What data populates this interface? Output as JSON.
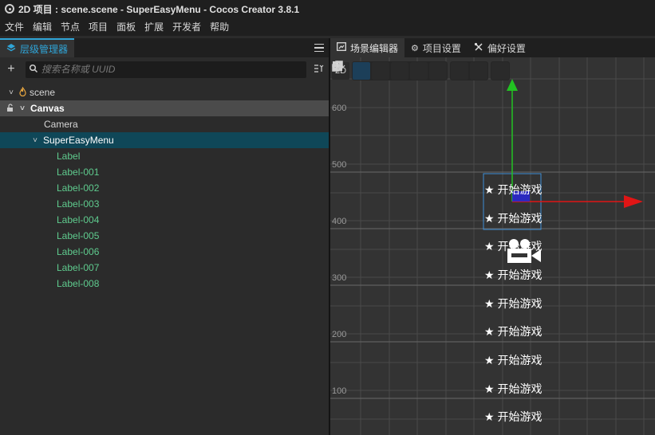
{
  "window": {
    "title": "2D 项目 : scene.scene - SuperEasyMenu - Cocos Creator 3.8.1"
  },
  "menu": [
    "文件",
    "编辑",
    "节点",
    "项目",
    "面板",
    "扩展",
    "开发者",
    "帮助"
  ],
  "hierarchy": {
    "tab_label": "层级管理器",
    "search_placeholder": "搜索名称或 UUID",
    "nodes": [
      {
        "label": "scene"
      },
      {
        "label": "Canvas"
      },
      {
        "label": "Camera"
      },
      {
        "label": "SuperEasyMenu"
      },
      {
        "label": "Label"
      },
      {
        "label": "Label-001"
      },
      {
        "label": "Label-002"
      },
      {
        "label": "Label-003"
      },
      {
        "label": "Label-004"
      },
      {
        "label": "Label-005"
      },
      {
        "label": "Label-006"
      },
      {
        "label": "Label-007"
      },
      {
        "label": "Label-008"
      }
    ]
  },
  "editor": {
    "tabs": [
      "场景编辑器",
      "项目设置",
      "偏好设置"
    ],
    "mode_2d": "2D",
    "y_axis_labels": [
      "600",
      "500",
      "400",
      "300",
      "200",
      "100"
    ],
    "menu_items": [
      "★ 开始游戏",
      "★ 开始游戏",
      "★ 开始游戏",
      "★ 开始游戏",
      "★ 开始游戏",
      "★ 开始游戏",
      "★ 开始游戏",
      "★ 开始游戏",
      "★ 开始游戏"
    ]
  },
  "colors": {
    "accent": "#2fa5d8",
    "selected_row": "#0f4758",
    "child_label": "#5fcb8e",
    "x_axis": "#e01515",
    "y_axis": "#22c122",
    "selection_box": "#3c8ed6"
  }
}
